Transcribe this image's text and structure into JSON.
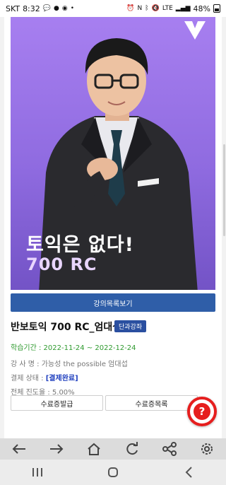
{
  "status_bar": {
    "carrier": "SKT",
    "time": "8:32",
    "battery": "48%",
    "icons": [
      "message-icon",
      "kakaotalk-icon",
      "notification-icon",
      "dot-icon",
      "alarm-icon",
      "nfc-icon",
      "bluetooth-icon",
      "mute-icon",
      "lte-icon",
      "signal-icon"
    ]
  },
  "banner": {
    "headline": "토익은 없다!",
    "subheadline": "700 RC",
    "logo": "v-logo"
  },
  "course_list_button": "강의목록보기",
  "course": {
    "title": "반보토익 700 RC_엄대섭",
    "badge": "단과강좌",
    "period_label": "학습기간 : ",
    "period_value": "2022-11-24 ~ 2022-12-24",
    "instructor_label": "강 사 명 : ",
    "instructor_value": "가능성 the possible 엄대섭",
    "payment_label": "결제 상태 : ",
    "payment_value": "[결제완료]",
    "progress_label": "전체 진도율 : ",
    "progress_value": "5.00%"
  },
  "buttons": {
    "certificate_issue": "수료증발급",
    "certificate_list": "수료증목록"
  },
  "help_button": "?",
  "browser_toolbar": [
    "back-icon",
    "forward-icon",
    "home-icon",
    "refresh-icon",
    "share-icon",
    "settings-icon"
  ],
  "nav_bar": [
    "recent-apps-icon",
    "home-button-icon",
    "back-button-icon"
  ],
  "colors": {
    "banner_top": "#a77ff0",
    "button_blue": "#2f5ea8",
    "period_green": "#2f9a2f",
    "fab_red": "#e61e1e"
  }
}
